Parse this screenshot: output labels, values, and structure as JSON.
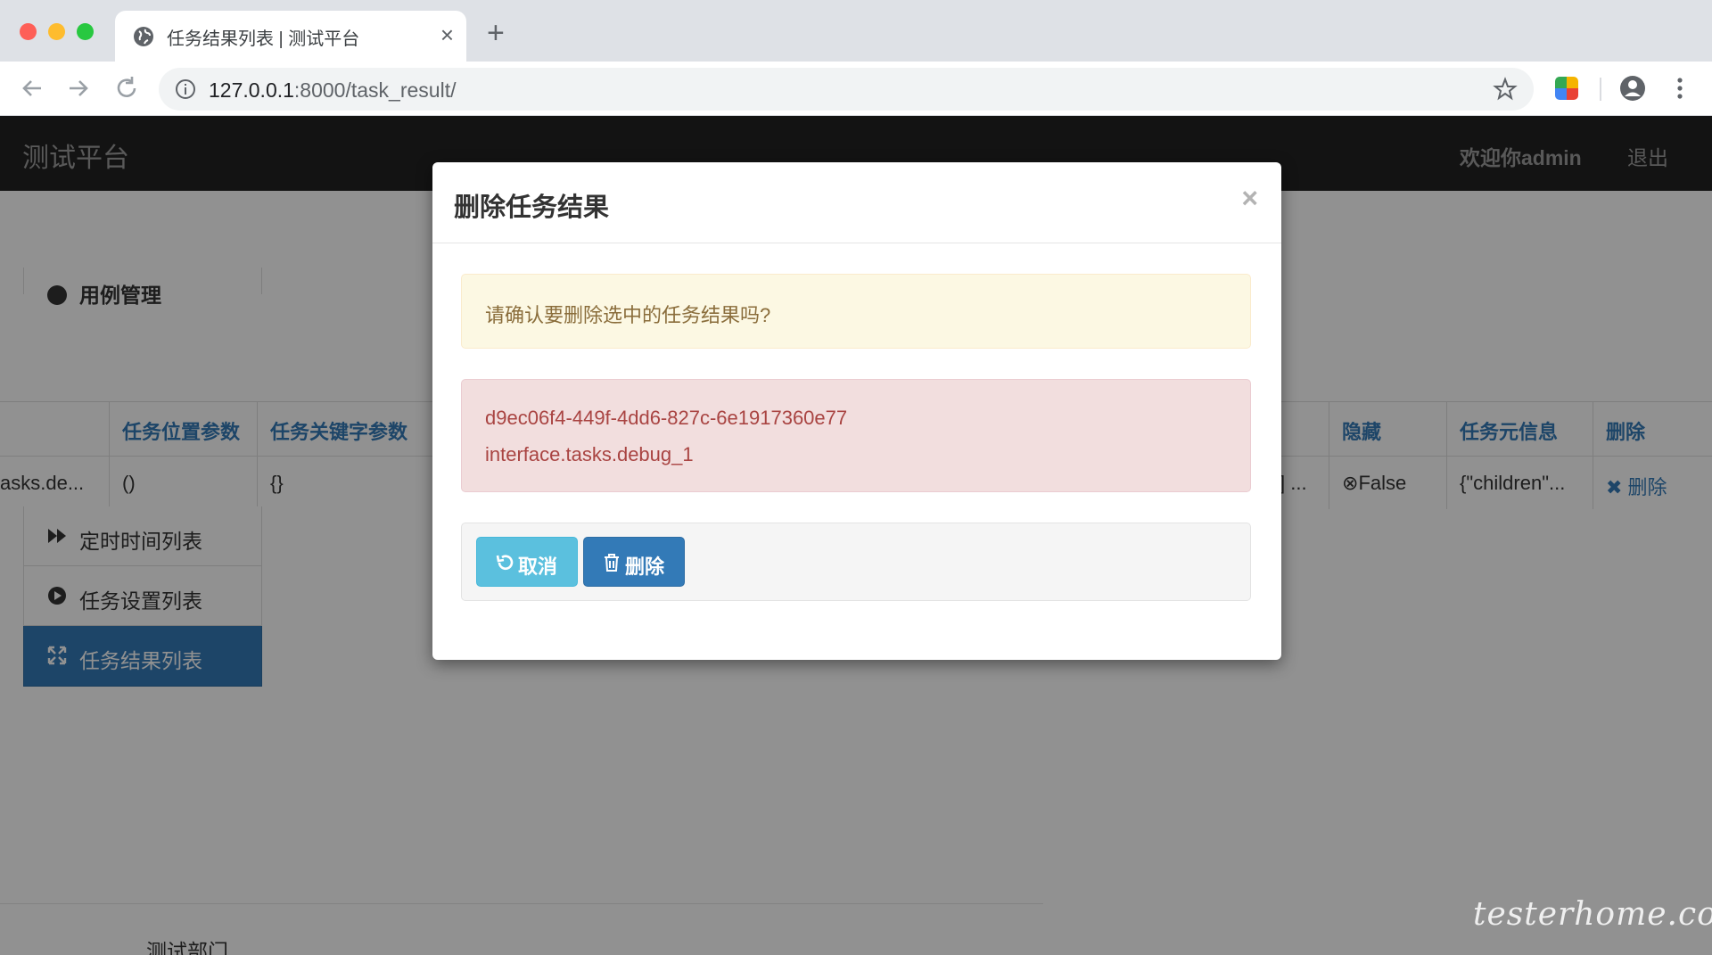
{
  "browser": {
    "tab_title": "任务结果列表 | 测试平台",
    "tab_close": "×",
    "new_tab": "+",
    "url_host": "127.0.0.1",
    "url_rest": ":8000/task_result/"
  },
  "navbar": {
    "brand": "测试平台",
    "welcome": "欢迎你admin",
    "logout": "退出"
  },
  "sidebar": {
    "partial_item": "用例管理",
    "items": [
      {
        "label": "定时时间列表",
        "icon": "forward-icon"
      },
      {
        "label": "任务设置列表",
        "icon": "play-circle-icon"
      },
      {
        "label": "任务结果列表",
        "icon": "fullscreen-icon",
        "active": true
      }
    ]
  },
  "table": {
    "headers": [
      "任务位置参数",
      "任务关键字参数",
      "隐藏",
      "任务元信息",
      "删除"
    ],
    "row": {
      "task_name": "asks.de...",
      "args": "()",
      "kwargs": "{}",
      "result_cut": "] ...",
      "hidden": "False",
      "meta": "{\"children\"...",
      "delete": "删除"
    }
  },
  "modal": {
    "title": "删除任务结果",
    "close": "×",
    "warning": "请确认要删除选中的任务结果吗?",
    "selected": [
      "d9ec06f4-449f-4dd6-827c-6e1917360e77",
      "interface.tasks.debug_1"
    ],
    "cancel_label": "取消",
    "delete_label": "删除"
  },
  "footer": {
    "text": "测试部门"
  },
  "watermark": "testerhome.com"
}
